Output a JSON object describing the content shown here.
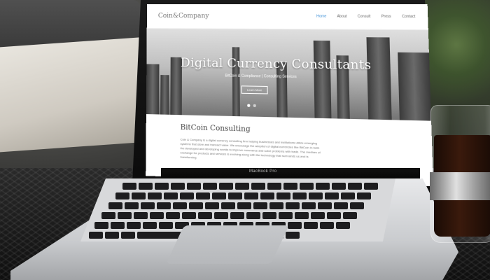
{
  "website": {
    "logo": "Coin&Company",
    "nav": [
      "Home",
      "About",
      "Consult",
      "Press",
      "Contact"
    ],
    "active_nav": "Home",
    "hero_title": "Digital Currency Consultants",
    "hero_subtitle": "BitCoin & Compliance | Consulting Services",
    "hero_button": "Learn More",
    "section_title": "BitCoin Consulting",
    "section_text": "Coin & Company is a digital currency consulting firm helping businesses and institutions utilize emerging systems that store and transact value. We encourage the adoption of digital currencies like BitCoin in both the developed and developing worlds to improve commerce and solve problems with trade. The medium of exchange for products and services is evolving along with the technology that surrounds us and is transforming"
  },
  "laptop": {
    "brand": "MacBook Pro"
  },
  "colors": {
    "accent": "#3b8fd6"
  }
}
